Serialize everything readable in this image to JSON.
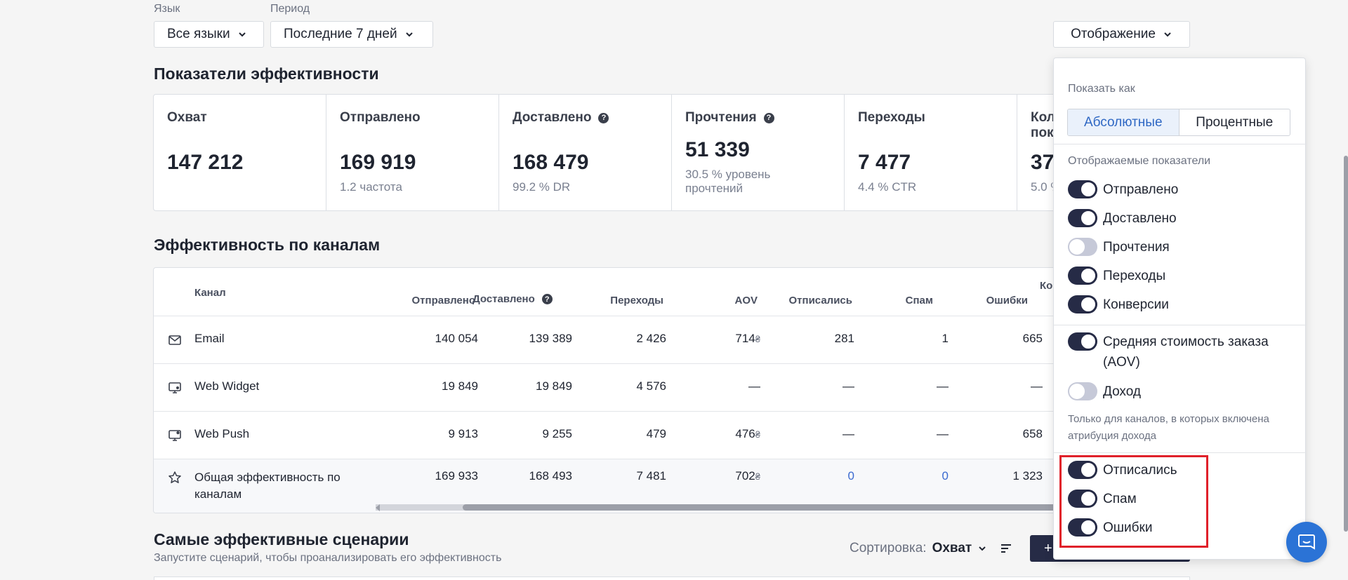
{
  "filters": {
    "language_label": "Язык",
    "language_value": "Все языки",
    "period_label": "Период",
    "period_value": "Последние 7 дней",
    "display_button": "Отображение"
  },
  "kpi_section": {
    "title": "Показатели эффективности",
    "cards": [
      {
        "title": "Охват",
        "value": "147 212",
        "sub": ""
      },
      {
        "title": "Отправлено",
        "value": "169 919",
        "sub": "1.2  частота"
      },
      {
        "title": "Доставлено",
        "value": "168 479",
        "sub": "99.2 % DR"
      },
      {
        "title": "Прочтения",
        "value": "51 339",
        "sub": "30.5 % уровень прочтений"
      },
      {
        "title": "Переходы",
        "value": "7 477",
        "sub": "4.4 % CTR"
      },
      {
        "title": "Кол",
        "title2": "пок",
        "value": "37",
        "sub": "5.0 %"
      }
    ]
  },
  "channels": {
    "title": "Эффективность по каналам",
    "headers": [
      "Канал",
      "Отправлено",
      "Доставлено",
      "Переходы",
      "AOV",
      "Отписались",
      "Спам",
      "Ошибки",
      "Ко"
    ],
    "rows": [
      {
        "icon": "mail-icon",
        "name": "Email",
        "cells": [
          "140 054",
          "139 389",
          "2 426",
          "714",
          "281",
          "1",
          "665"
        ]
      },
      {
        "icon": "web-widget-icon",
        "name": "Web Widget",
        "cells": [
          "19 849",
          "19 849",
          "4 576",
          "—",
          "—",
          "—",
          "—"
        ]
      },
      {
        "icon": "web-push-icon",
        "name": "Web Push",
        "cells": [
          "9 913",
          "9 255",
          "479",
          "476",
          "—",
          "—",
          "658"
        ]
      },
      {
        "icon": "star-icon",
        "name": "Общая эффективность по каналам",
        "cells": [
          "169 933",
          "168 493",
          "7 481",
          "702",
          "0",
          "0",
          "1 323"
        ]
      }
    ],
    "currency": "₴"
  },
  "scenarios": {
    "title": "Самые эффективные сценарии",
    "subtitle": "Запустите сценарий, чтобы проанализировать его эффективность",
    "sort_label": "Сортировка:",
    "sort_value": "Охват",
    "create_button": "+"
  },
  "display_panel": {
    "show_as_label": "Показать как",
    "absolute": "Абсолютные",
    "percent": "Процентные",
    "metrics_label": "Отображаемые показатели",
    "toggles": [
      {
        "label": "Отправлено",
        "on": true
      },
      {
        "label": "Доставлено",
        "on": true
      },
      {
        "label": "Прочтения",
        "on": false
      },
      {
        "label": "Переходы",
        "on": true
      },
      {
        "label": "Конверсии",
        "on": true
      },
      {
        "label": "Средняя стоимость заказа (AOV)",
        "on": true
      },
      {
        "label": "Доход",
        "on": false
      },
      {
        "label": "Отписались",
        "on": true
      },
      {
        "label": "Спам",
        "on": true
      },
      {
        "label": "Ошибки",
        "on": true
      }
    ],
    "revenue_note": "Только для каналов, в которых включена атрибуция дохода"
  },
  "colors": {
    "accent": "#2f68c4",
    "toggle_on": "#262b46",
    "highlight": "#e0202a",
    "chat": "#2b73d6"
  }
}
